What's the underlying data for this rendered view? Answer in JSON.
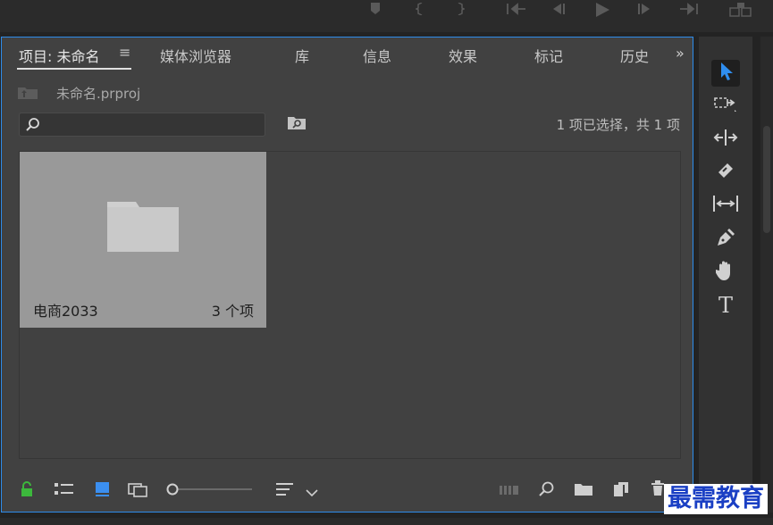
{
  "tabs": [
    {
      "label": "项目: 未命名",
      "active": true
    },
    {
      "label": "媒体浏览器"
    },
    {
      "label": "库"
    },
    {
      "label": "信息"
    },
    {
      "label": "效果"
    },
    {
      "label": "标记"
    },
    {
      "label": "历史"
    }
  ],
  "tab_menu_glyph": "≡",
  "more_glyph": "»",
  "project": {
    "file_name": "未命名.prproj",
    "selection_status": "1 项已选择，共 1 项",
    "search": {
      "value": "",
      "placeholder": ""
    }
  },
  "bins": [
    {
      "name": "电商2033",
      "item_count": "3 个项"
    }
  ],
  "tools": [
    {
      "name": "selection-tool",
      "selected": true
    },
    {
      "name": "track-select-tool"
    },
    {
      "name": "ripple-edit-tool"
    },
    {
      "name": "razor-tool"
    },
    {
      "name": "slip-tool"
    },
    {
      "name": "pen-tool"
    },
    {
      "name": "hand-tool"
    },
    {
      "name": "type-tool",
      "glyph": "T"
    }
  ],
  "colors": {
    "accent": "#2d8ceb",
    "panel_bg": "#414141",
    "bin_card": "#999999",
    "lock_green": "#3cb83c",
    "list_view_blue": "#3b8ff0",
    "watermark": "#1a3fc4"
  },
  "watermark": "最需教育"
}
